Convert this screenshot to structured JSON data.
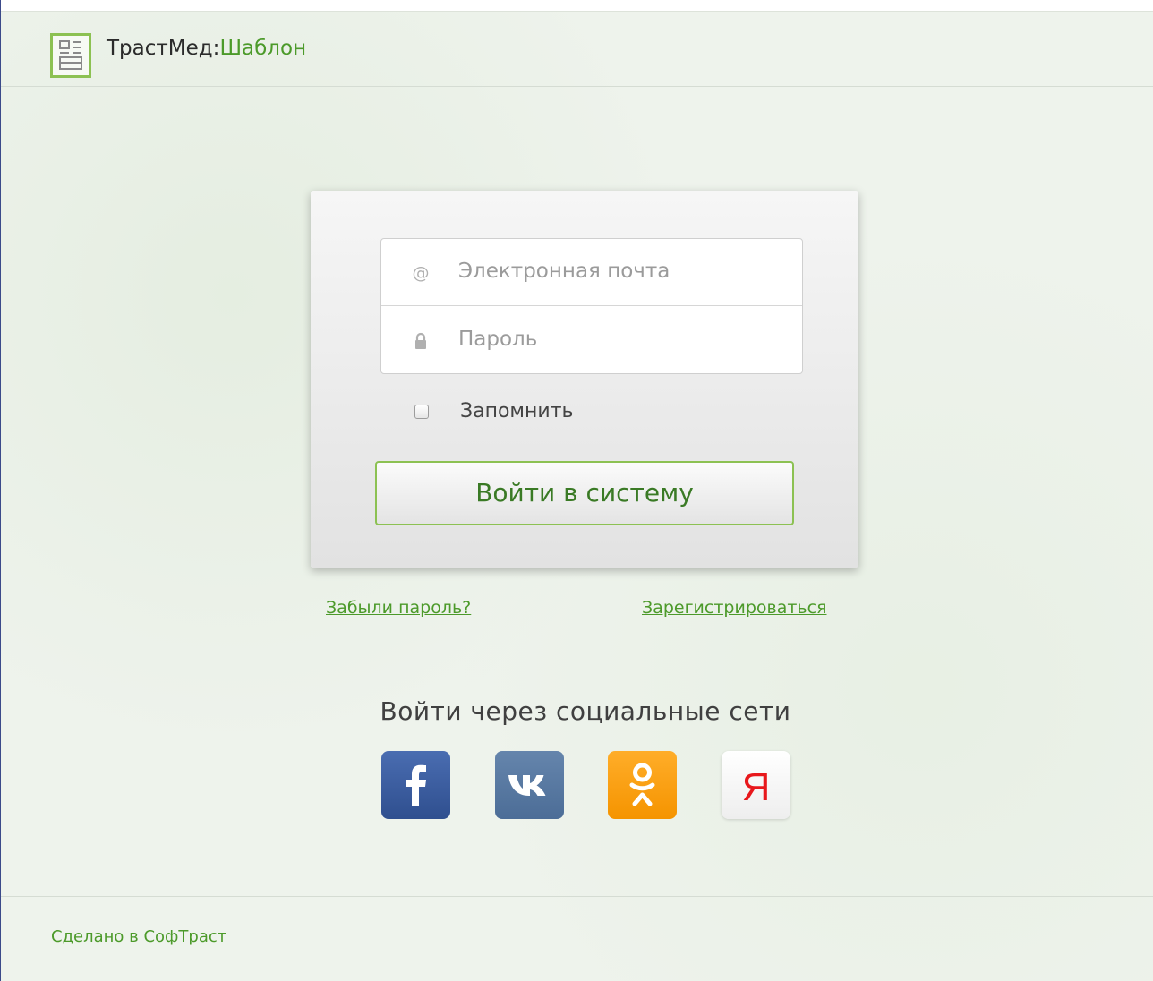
{
  "header": {
    "brand": "ТрастМед:",
    "brand_accent": "Шаблон",
    "logo_icon": "document-layout-icon"
  },
  "login_form": {
    "email": {
      "placeholder": "Электронная почта",
      "value": "",
      "icon": "at-sign-icon"
    },
    "password": {
      "placeholder": "Пароль",
      "value": "",
      "icon": "lock-icon"
    },
    "remember": {
      "label": "Запомнить",
      "checked": false
    },
    "submit_label": "Войти в систему"
  },
  "links": {
    "forgot_password": "Забыли пароль?",
    "register": "Зарегистрироваться"
  },
  "social": {
    "title": "Войти через социальные сети",
    "providers": [
      {
        "name": "facebook",
        "icon": "facebook-icon",
        "color": "#3b5998"
      },
      {
        "name": "vkontakte",
        "icon": "vk-icon",
        "color": "#5b7aa2"
      },
      {
        "name": "odnoklassniki",
        "icon": "odnoklassniki-icon",
        "color": "#f7a01d"
      },
      {
        "name": "yandex",
        "icon": "yandex-icon",
        "color": "#ff0000",
        "glyph": "Я"
      }
    ]
  },
  "footer": {
    "made_by": "Сделано в СофТраст"
  },
  "colors": {
    "accent": "#8cc152",
    "link": "#4c9a2a",
    "background": "#eef3ec"
  }
}
